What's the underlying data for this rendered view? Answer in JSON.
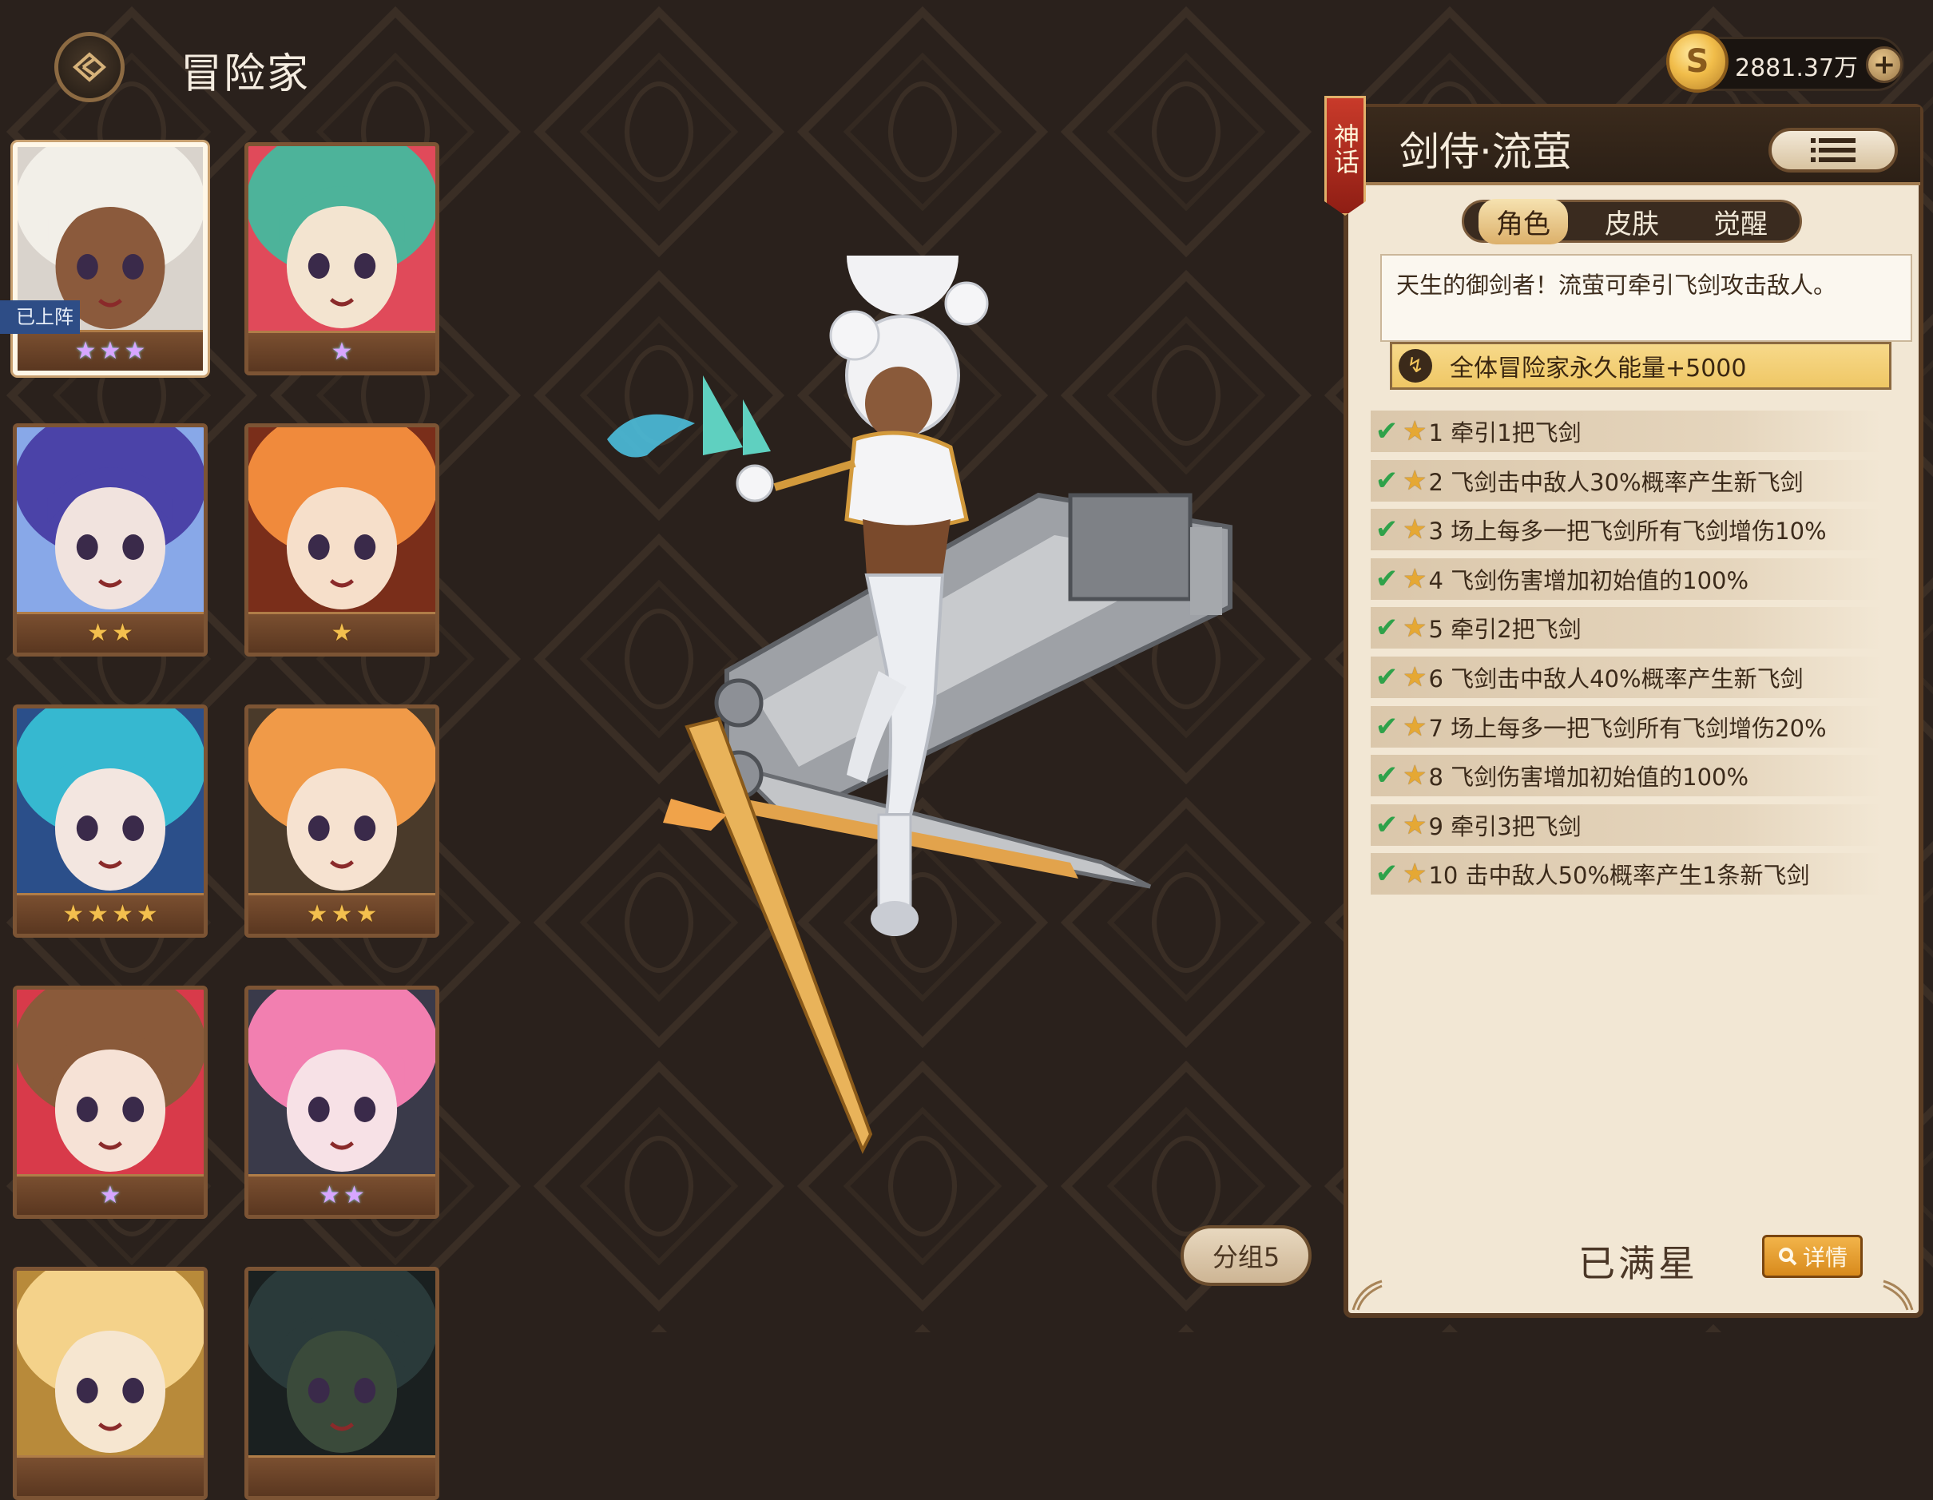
{
  "header": {
    "title": "冒险家"
  },
  "currency": {
    "amount": "2881.37万",
    "icon": "gold-coin-icon",
    "plus": "+"
  },
  "roster": [
    {
      "stars": 3,
      "star_style": "rainbow",
      "deployed": true,
      "palette": [
        "#f2efe8",
        "#8b5a3c",
        "#d9d3cc"
      ]
    },
    {
      "stars": 1,
      "star_style": "rainbow",
      "deployed": false,
      "palette": [
        "#4db39a",
        "#f3e4d0",
        "#e04a5a"
      ]
    },
    {
      "stars": 2,
      "star_style": "gold",
      "deployed": false,
      "palette": [
        "#4b43a8",
        "#f1e3de",
        "#88a8e8"
      ]
    },
    {
      "stars": 1,
      "star_style": "gold",
      "deployed": false,
      "palette": [
        "#f08a3c",
        "#f6dfca",
        "#7a2e1a"
      ]
    },
    {
      "stars": 4,
      "star_style": "gold",
      "deployed": false,
      "palette": [
        "#36b8d0",
        "#f3e6e0",
        "#2b4f8a"
      ]
    },
    {
      "stars": 3,
      "star_style": "gold",
      "deployed": false,
      "palette": [
        "#f09a48",
        "#f6e2d0",
        "#4a3a2a"
      ]
    },
    {
      "stars": 1,
      "star_style": "rainbow",
      "deployed": false,
      "palette": [
        "#8a5a3a",
        "#f6e2d6",
        "#d83a4a"
      ]
    },
    {
      "stars": 2,
      "star_style": "rainbow",
      "deployed": false,
      "palette": [
        "#f27fb0",
        "#f7e1e6",
        "#3a3a4a"
      ]
    },
    {
      "stars": 0,
      "star_style": "gold",
      "deployed": false,
      "palette": [
        "#f4d28a",
        "#f6e6d0",
        "#b88a3a"
      ]
    },
    {
      "stars": 0,
      "star_style": "gold",
      "deployed": false,
      "palette": [
        "#2a3a3a",
        "#3a4a3a",
        "#1a2020"
      ]
    }
  ],
  "deployed_badge": "已上阵",
  "group_button": "分组5",
  "hero": {
    "rank": "神话",
    "name": "剑侍·流萤",
    "tabs": [
      "角色",
      "皮肤",
      "觉醒"
    ],
    "active_tab": "角色",
    "description": "天生的御剑者！流萤可牵引飞剑攻击敌人。",
    "permanent_bonus": "全体冒险家永久能量+5000",
    "skills": [
      "1 牵引1把飞剑",
      "2 飞剑击中敌人30%概率产生新飞剑",
      "3 场上每多一把飞剑所有飞剑增伤10%",
      "4 飞剑伤害增加初始值的100%",
      "5 牵引2把飞剑",
      "6 飞剑击中敌人40%概率产生新飞剑",
      "7 场上每多一把飞剑所有飞剑增伤20%",
      "8 飞剑伤害增加初始值的100%",
      "9 牵引3把飞剑",
      "10 击中敌人50%概率产生1条新飞剑"
    ],
    "max_star_text": "已满星",
    "detail_button": "详情"
  },
  "colors": {
    "accent_gold": "#f3c04e",
    "panel_bg": "#f2e7d4",
    "check_green": "#2fa24a",
    "ribbon_red": "#c83a2a"
  }
}
